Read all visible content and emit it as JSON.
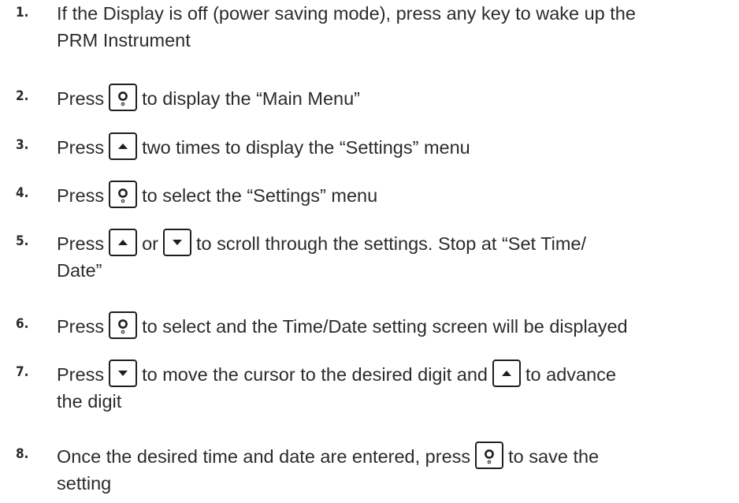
{
  "steps": [
    {
      "number": "1.",
      "line1": "If the Display is off (power saving mode), press any key to wake up the",
      "line2": "PRM Instrument"
    },
    {
      "number": "2.",
      "before": "Press",
      "after": "to display the “Main Menu”",
      "key": "enter-key-icon"
    },
    {
      "number": "3.",
      "before": "Press",
      "after": "two times to display the “Settings” menu",
      "key": "up-arrow-key-icon"
    },
    {
      "number": "4.",
      "before": "Press",
      "after": "to select the “Settings” menu",
      "key": "enter-key-icon"
    },
    {
      "number": "5.",
      "before": "Press",
      "middle": "or",
      "after": "to scroll through the settings. Stop at “Set Time/",
      "line2": "Date”",
      "keys": [
        "up-arrow-key-icon",
        "down-arrow-key-icon"
      ]
    },
    {
      "number": "6.",
      "before": "Press",
      "after": "to select and the Time/Date setting screen will be displayed",
      "key": "enter-key-icon"
    },
    {
      "number": "7.",
      "before": "Press",
      "middle": "to move the cursor to the desired digit and",
      "after": "to advance",
      "line2": "the digit",
      "keys": [
        "down-arrow-key-icon",
        "up-arrow-key-icon"
      ]
    },
    {
      "number": "8.",
      "before": "Once the desired time and date are entered, press",
      "after": "to save the",
      "line2": "setting",
      "key": "enter-key-icon"
    }
  ]
}
